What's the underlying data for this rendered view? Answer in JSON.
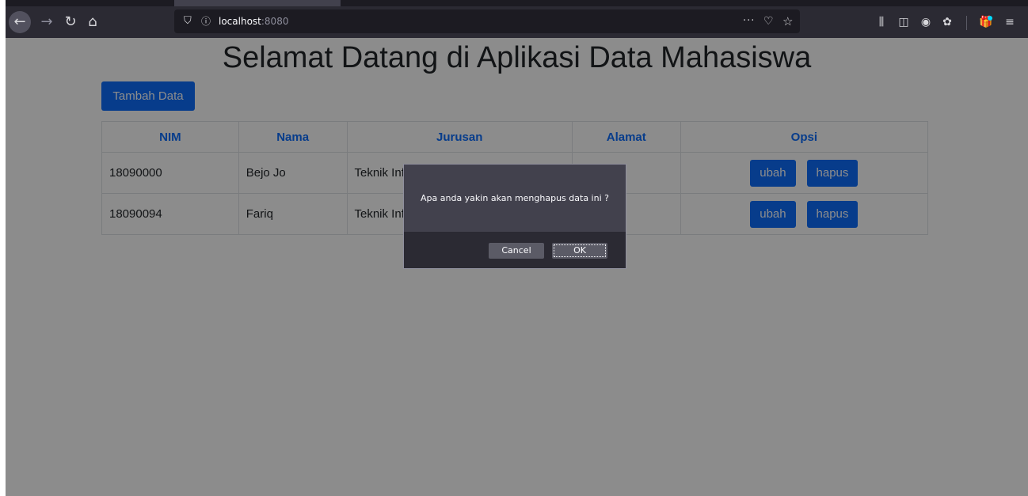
{
  "browser": {
    "url_host": "localhost",
    "url_port": ":8080",
    "icons": {
      "back": "←",
      "forward": "→",
      "reload": "↻",
      "home": "⌂",
      "shield": "⛉",
      "info": "ⓘ",
      "page_actions": "···",
      "pocket": "♡",
      "bookmark_star": "☆",
      "library": "⫼",
      "sidebar": "◫",
      "account": "◉",
      "extension": "✿",
      "whatsnew": "🎁",
      "menu": "≡"
    }
  },
  "page": {
    "title": "Selamat Datang di Aplikasi Data Mahasiswa",
    "add_button_label": "Tambah Data",
    "table": {
      "headers": [
        "NIM",
        "Nama",
        "Jurusan",
        "Alamat",
        "Opsi"
      ],
      "rows": [
        {
          "nim": "18090000",
          "nama": "Bejo Jo",
          "jurusan": "Teknik Inf",
          "alamat": ""
        },
        {
          "nim": "18090094",
          "nama": "Fariq",
          "jurusan": "Teknik Inf",
          "alamat": ""
        }
      ],
      "edit_label": "ubah",
      "separator": "|",
      "delete_label": "hapus"
    }
  },
  "dialog": {
    "message": "Apa anda yakin akan menghapus data ini ?",
    "cancel_label": "Cancel",
    "ok_label": "OK"
  },
  "colors": {
    "primary": "#0d6efd",
    "chrome_bg": "#2b2a33",
    "dialog_bg": "#42414d"
  }
}
